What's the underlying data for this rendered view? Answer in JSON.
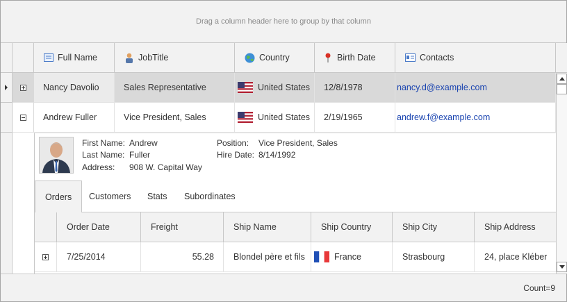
{
  "group_panel": {
    "text": "Drag a column header here to group by that column"
  },
  "columns": [
    {
      "label": "Full Name",
      "icon": "name-card-icon"
    },
    {
      "label": "JobTitle",
      "icon": "person-icon"
    },
    {
      "label": "Country",
      "icon": "globe-icon"
    },
    {
      "label": "Birth Date",
      "icon": "pin-icon"
    },
    {
      "label": "Contacts",
      "icon": "contact-card-icon"
    }
  ],
  "rows": [
    {
      "name": "Nancy Davolio",
      "title": "Sales Representative",
      "country": "United States",
      "birth": "12/8/1978",
      "email": "nancy.d@example.com",
      "expanded": false
    },
    {
      "name": "Andrew Fuller",
      "title": "Vice President, Sales",
      "country": "United States",
      "birth": "2/19/1965",
      "email": "andrew.f@example.com",
      "expanded": true
    }
  ],
  "detail": {
    "first_name_label": "First Name:",
    "first_name": "Andrew",
    "last_name_label": "Last Name:",
    "last_name": "Fuller",
    "address_label": "Address:",
    "address": "908 W. Capital Way",
    "position_label": "Position:",
    "position": "Vice President, Sales",
    "hire_label": "Hire Date:",
    "hire": "8/14/1992",
    "tabs": [
      "Orders",
      "Customers",
      "Stats",
      "Subordinates"
    ],
    "active_tab": "Orders",
    "sub_columns": [
      "Order Date",
      "Freight",
      "Ship Name",
      "Ship Country",
      "Ship City",
      "Ship Address"
    ],
    "sub_rows": [
      {
        "date": "7/25/2014",
        "freight": "55.28",
        "ship_name": "Blondel père et fils",
        "ship_country": "France",
        "ship_city": "Strasbourg",
        "ship_address": "24, place Kléber"
      }
    ]
  },
  "footer": {
    "count": "Count=9"
  },
  "colors": {
    "selected_row": "#d9d9d9",
    "header_bg": "#f2f2f2",
    "link": "#1a44b0"
  }
}
